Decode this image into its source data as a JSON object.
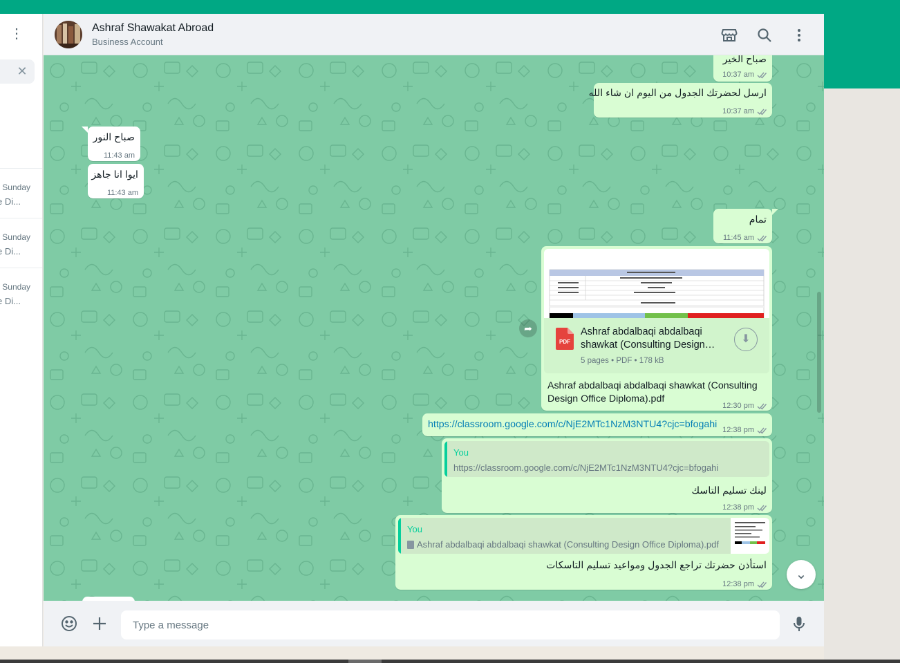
{
  "contact": {
    "name": "Ashraf Shawakat Abroad",
    "subtitle": "Business Account"
  },
  "header_icons": [
    "store-icon",
    "search-icon",
    "menu-icon"
  ],
  "sidebar": {
    "items": [
      {
        "day": "Sunday",
        "snippet": "e Di..."
      },
      {
        "day": "Sunday",
        "snippet": "e Di..."
      },
      {
        "day": "Sunday",
        "snippet": "e Di..."
      }
    ]
  },
  "messages": [
    {
      "dir": "out",
      "text": "صباح الخير",
      "time": "10:37 am"
    },
    {
      "dir": "out",
      "text": "ارسل لحضرتك الجدول من اليوم ان شاء الله",
      "time": "10:37 am"
    },
    {
      "dir": "in",
      "text": "صباح النور",
      "time": "11:43 am"
    },
    {
      "dir": "in",
      "text": "ايوا انا جاهز",
      "time": "11:43 am"
    },
    {
      "dir": "out",
      "text": "تمام",
      "time": "11:45 am"
    },
    {
      "dir": "out",
      "type": "document",
      "doc_title": "Ashraf abdalbaqi abdalbaqi shawkat (Consulting Design…",
      "doc_info": "5 pages • PDF • 178 kB",
      "pdf_label": "PDF",
      "caption": "Ashraf abdalbaqi abdalbaqi shawkat (Consulting Design Office Diploma).pdf",
      "time": "12:30 pm"
    },
    {
      "dir": "out",
      "type": "link",
      "text": "https://classroom.google.com/c/NjE2MTc1NzM3NTU4?cjc=bfogahi",
      "time": "12:38 pm"
    },
    {
      "dir": "out",
      "type": "reply",
      "quote_author": "You",
      "quote_text": "https://classroom.google.com/c/NjE2MTc1NzM3NTU4?cjc=bfogahi",
      "text": "لينك تسليم التاسك",
      "time": "12:38 pm"
    },
    {
      "dir": "out",
      "type": "reply",
      "quote_author": "You",
      "quote_text": "Ashraf abdalbaqi abdalbaqi shawkat (Consulting Design Office Diploma).pdf",
      "text": "استأذن حضرتك تراجع الجدول ومواعيد تسليم التاسكات",
      "time": "12:38 pm"
    }
  ],
  "composer": {
    "placeholder": "Type a message"
  },
  "colors": {
    "accent": "#00a884",
    "outgoing": "#d9fdd3",
    "incoming": "#ffffff",
    "wallpaper": "#7fcba5",
    "link": "#027eb5"
  }
}
